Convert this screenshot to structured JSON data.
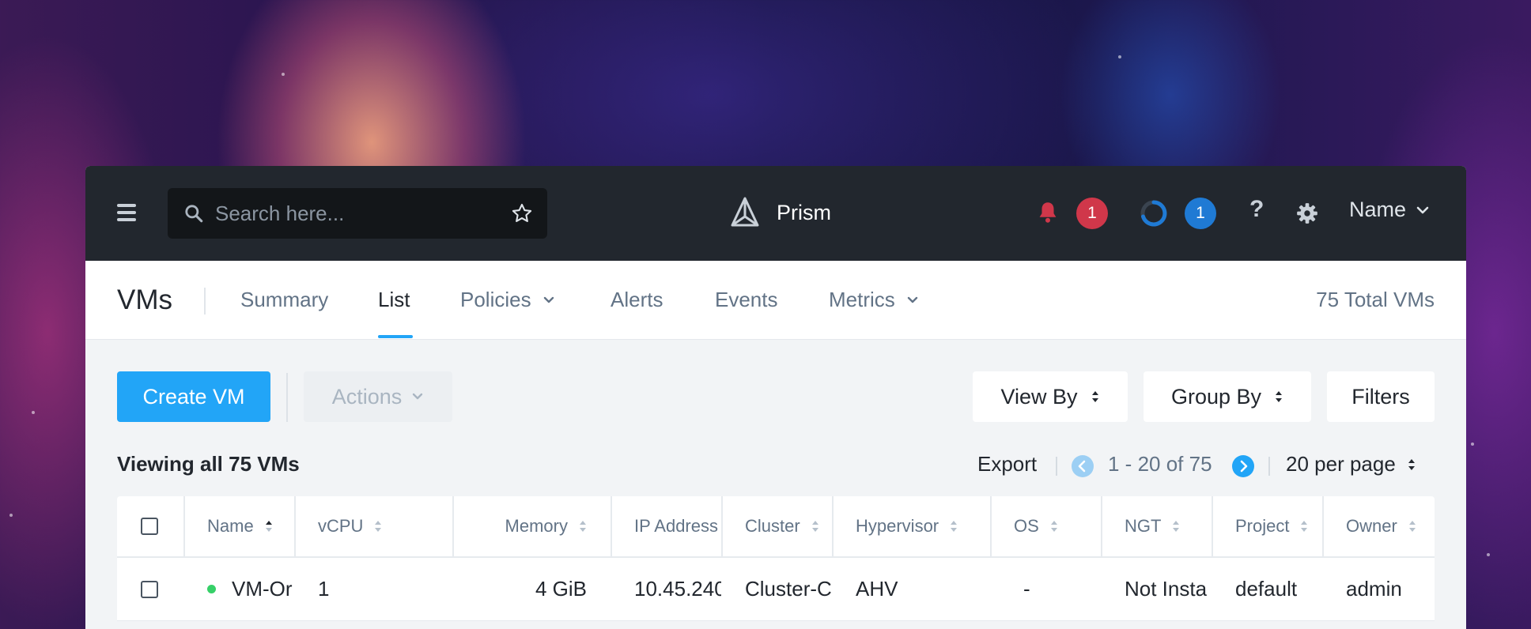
{
  "topbar": {
    "search_placeholder": "Search here...",
    "brand": "Prism",
    "alerts_count": "1",
    "tasks_count": "1",
    "help": "?",
    "user": "Name",
    "accent_alert": "#d0374a",
    "accent_task": "#1f7ad4"
  },
  "nav": {
    "section": "VMs",
    "tabs": [
      {
        "label": "Summary"
      },
      {
        "label": "List"
      },
      {
        "label": "Policies"
      },
      {
        "label": "Alerts"
      },
      {
        "label": "Events"
      },
      {
        "label": "Metrics"
      }
    ],
    "active_tab": "List",
    "total": "75 Total VMs"
  },
  "toolbar": {
    "create": "Create VM",
    "actions": "Actions",
    "view_by": "View By",
    "group_by": "Group By",
    "filters": "Filters",
    "primary_color": "#22a5f7"
  },
  "listbar": {
    "viewing": "Viewing all 75 VMs",
    "export": "Export",
    "range": "1 - 20 of 75",
    "per_page": "20 per page"
  },
  "table": {
    "columns": [
      "Name",
      "vCPU",
      "Memory",
      "IP Address",
      "Cluster",
      "Hypervisor",
      "OS",
      "NGT",
      "Project",
      "Owner"
    ],
    "rows": [
      {
        "status": "on",
        "name": "VM-Or",
        "vcpu": "1",
        "memory": "4 GiB",
        "ip": "10.45.240",
        "cluster": "Cluster-C",
        "hypervisor": "AHV",
        "os": "-",
        "ngt": "Not Insta",
        "project": "default",
        "owner": "admin"
      }
    ]
  }
}
